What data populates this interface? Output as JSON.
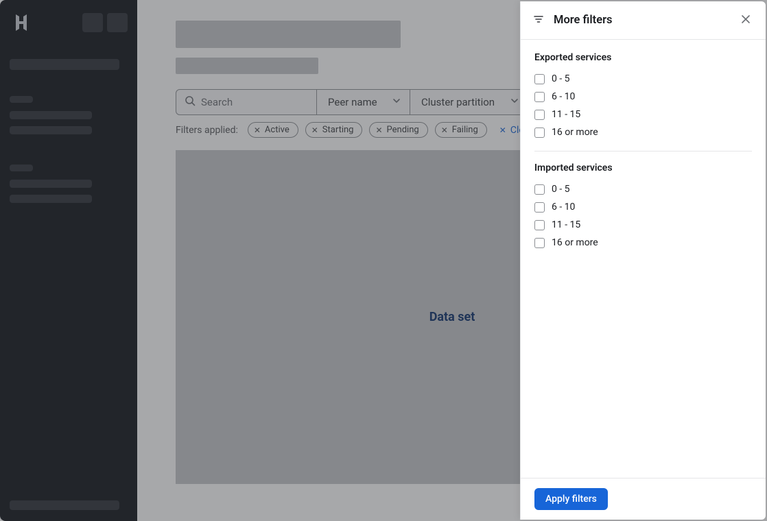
{
  "toolbar": {
    "search_placeholder": "Search",
    "dropdowns": {
      "peer_name": "Peer name",
      "cluster_partition": "Cluster partition"
    }
  },
  "filters": {
    "label": "Filters applied:",
    "chips": [
      "Active",
      "Starting",
      "Pending",
      "Failing"
    ],
    "clear_label": "Clear filters"
  },
  "main": {
    "data_set_label": "Data set"
  },
  "panel": {
    "title": "More filters",
    "apply_label": "Apply filters",
    "sections": {
      "exported": {
        "title": "Exported services",
        "options": [
          "0 - 5",
          "6 - 10",
          "11 - 15",
          "16 or more"
        ]
      },
      "imported": {
        "title": "Imported services",
        "options": [
          "0 - 5",
          "6 - 10",
          "11 - 15",
          "16 or more"
        ]
      }
    }
  }
}
